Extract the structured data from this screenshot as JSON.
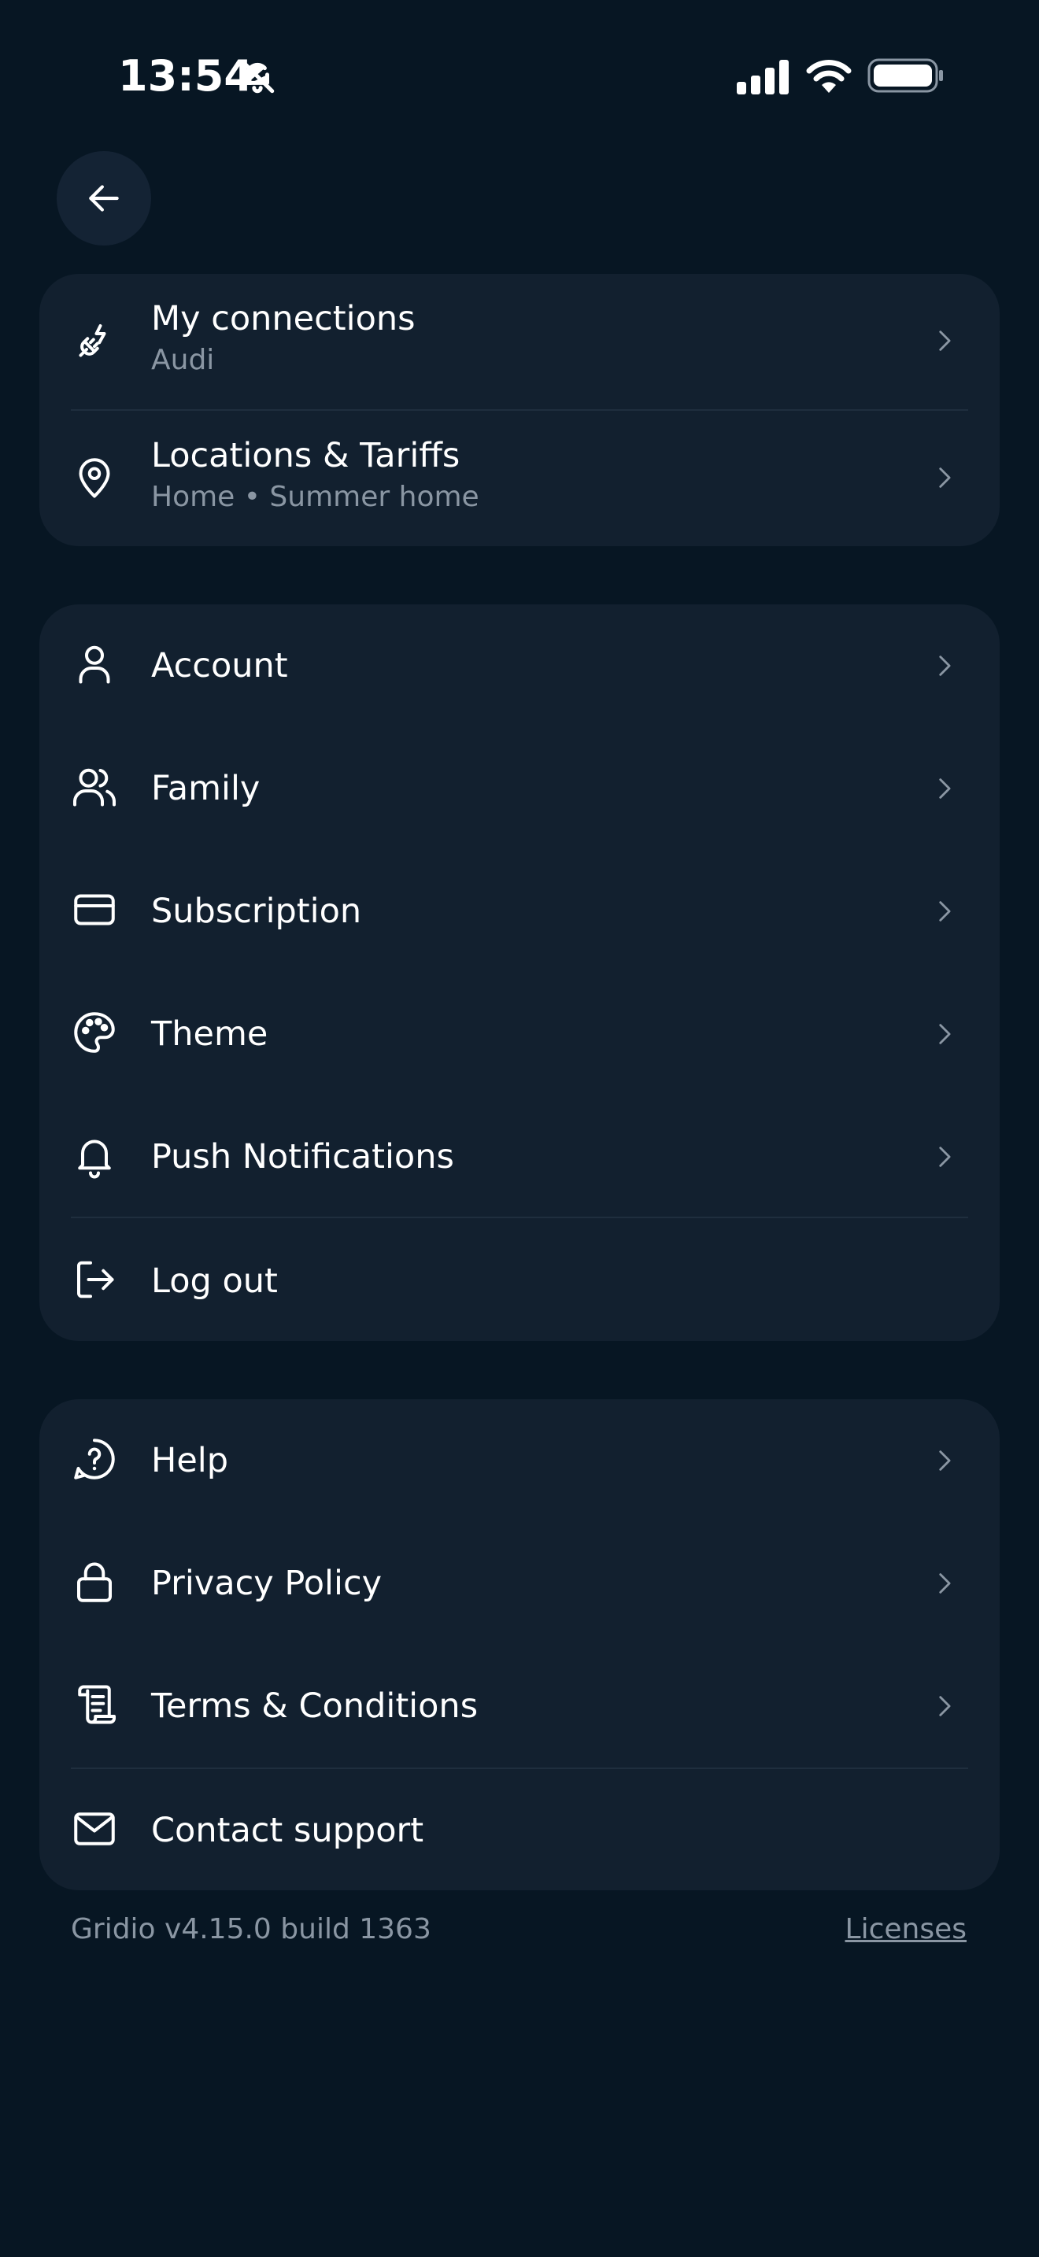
{
  "status_bar": {
    "time": "13:54"
  },
  "sections": {
    "vehicles": {
      "connections": {
        "label": "My connections",
        "sub": "Audi"
      },
      "locations": {
        "label": "Locations & Tariffs",
        "sub": "Home • Summer home"
      }
    },
    "account": {
      "account": {
        "label": "Account"
      },
      "family": {
        "label": "Family"
      },
      "subscription": {
        "label": "Subscription"
      },
      "theme": {
        "label": "Theme"
      },
      "notifications": {
        "label": "Push Notifications"
      },
      "logout": {
        "label": "Log out"
      }
    },
    "support": {
      "help": {
        "label": "Help"
      },
      "privacy": {
        "label": "Privacy Policy"
      },
      "terms": {
        "label": "Terms & Conditions"
      },
      "contact": {
        "label": "Contact support"
      }
    }
  },
  "footer": {
    "version": "Gridio v4.15.0 build 1363",
    "licenses": "Licenses"
  },
  "colors": {
    "background": "#071623",
    "card": "#12202f",
    "secondary_text": "#8a96a3"
  }
}
